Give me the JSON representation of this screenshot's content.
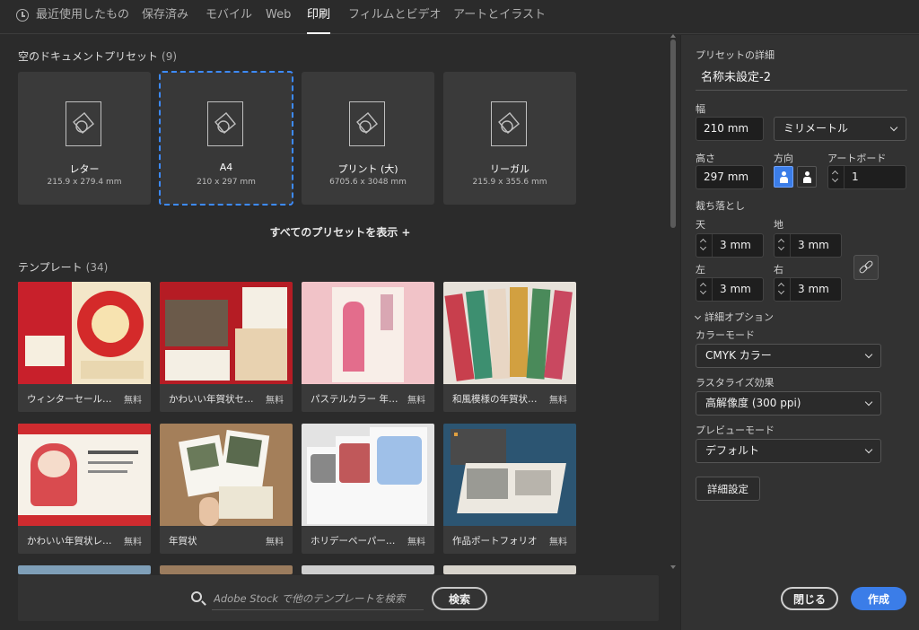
{
  "tabs": [
    {
      "label": "最近使用したもの",
      "active": false
    },
    {
      "label": "保存済み",
      "active": false
    },
    {
      "label": "モバイル",
      "active": false
    },
    {
      "label": "Web",
      "active": false
    },
    {
      "label": "印刷",
      "active": true
    },
    {
      "label": "フィルムとビデオ",
      "active": false
    },
    {
      "label": "アートとイラスト",
      "active": false
    }
  ],
  "presets_section": {
    "title": "空のドキュメントプリセット",
    "count": "(9)"
  },
  "presets": [
    {
      "name": "レター",
      "size": "215.9 x 279.4 mm",
      "selected": false
    },
    {
      "name": "A4",
      "size": "210 x 297 mm",
      "selected": true
    },
    {
      "name": "プリント (大)",
      "size": "6705.6 x 3048 mm",
      "selected": false
    },
    {
      "name": "リーガル",
      "size": "215.9 x 355.6 mm",
      "selected": false
    }
  ],
  "show_all_label": "すべてのプリセットを表示 +",
  "templates_section": {
    "title": "テンプレート",
    "count": "(34)"
  },
  "templates": [
    {
      "name": "ウィンターセール…",
      "price": "無料",
      "thumb": "winter-sale"
    },
    {
      "name": "かわいい年賀状セ…",
      "price": "無料",
      "thumb": "cute-newyear-set"
    },
    {
      "name": "パステルカラー 年…",
      "price": "無料",
      "thumb": "pastel-newyear"
    },
    {
      "name": "和風模様の年賀状…",
      "price": "無料",
      "thumb": "japanese-pattern"
    },
    {
      "name": "かわいい年賀状レ…",
      "price": "無料",
      "thumb": "cute-newyear-layout"
    },
    {
      "name": "年賀状",
      "price": "無料",
      "thumb": "newyear-card"
    },
    {
      "name": "ホリデーペーパー…",
      "price": "無料",
      "thumb": "holiday-paper"
    },
    {
      "name": "作品ポートフォリオ",
      "price": "無料",
      "thumb": "portfolio"
    }
  ],
  "search": {
    "placeholder": "Adobe Stock で他のテンプレートを検索",
    "button_label": "検索"
  },
  "panel": {
    "title": "プリセットの詳細",
    "document_name": "名称未設定-2",
    "width_label": "幅",
    "width_value": "210 mm",
    "unit_value": "ミリメートル",
    "height_label": "高さ",
    "height_value": "297 mm",
    "orientation_label": "方向",
    "artboard_label": "アートボード",
    "artboard_value": "1",
    "bleed_label": "裁ち落とし",
    "bleed_top_label": "天",
    "bleed_top_value": "3 mm",
    "bleed_bottom_label": "地",
    "bleed_bottom_value": "3 mm",
    "bleed_left_label": "左",
    "bleed_left_value": "3 mm",
    "bleed_right_label": "右",
    "bleed_right_value": "3 mm",
    "advanced_options_label": "詳細オプション",
    "color_mode_label": "カラーモード",
    "color_mode_value": "CMYK カラー",
    "raster_label": "ラスタライズ効果",
    "raster_value": "高解像度 (300 ppi)",
    "preview_label": "プレビューモード",
    "preview_value": "デフォルト",
    "advanced_settings_label": "詳細設定",
    "close_label": "閉じる",
    "create_label": "作成"
  },
  "colors": {
    "accent": "#3b7de8",
    "background": "#2b2b2b",
    "panel": "#323232",
    "card": "#3a3a3a"
  }
}
